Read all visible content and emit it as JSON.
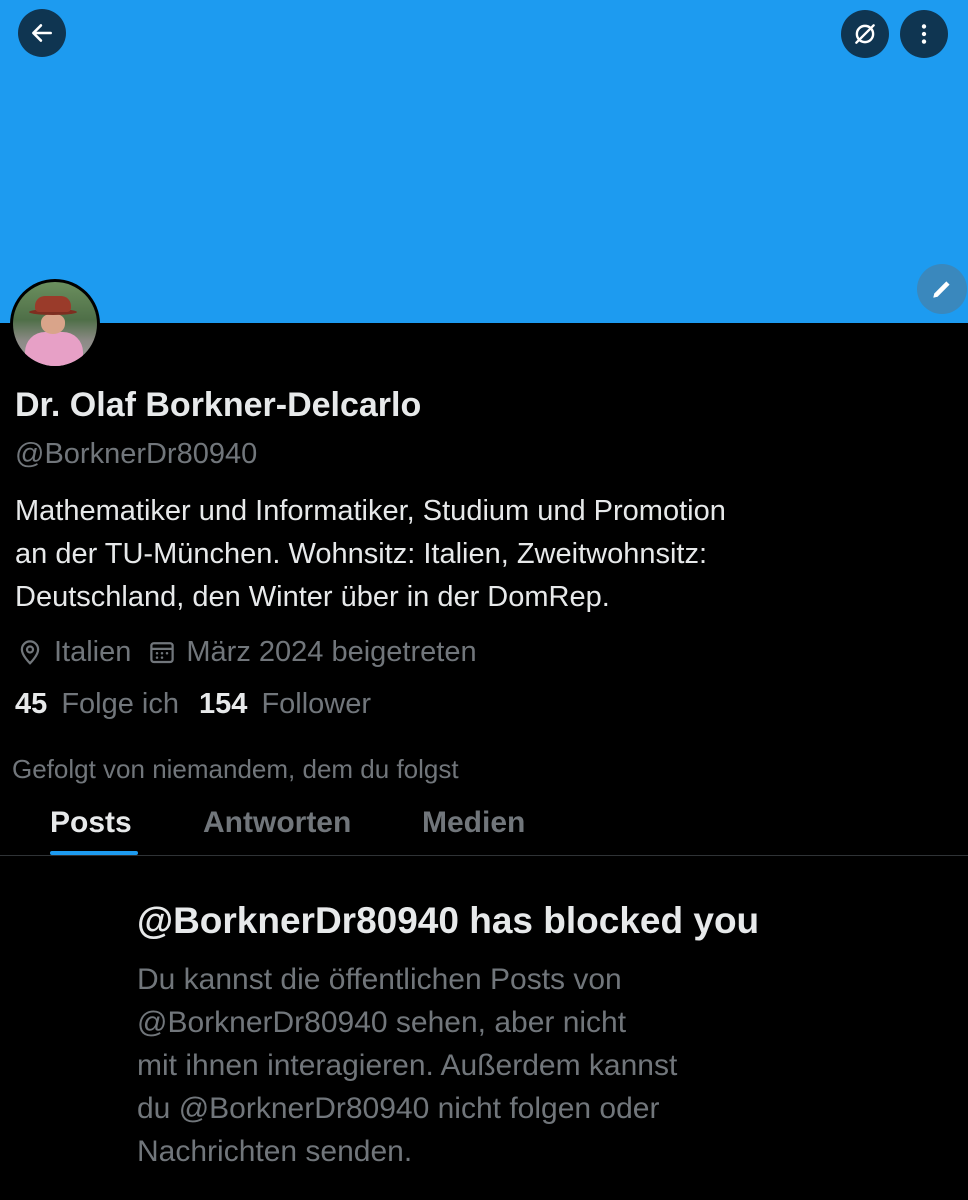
{
  "profile": {
    "name": "Dr. Olaf Borkner-Delcarlo",
    "handle": "@BorknerDr80940",
    "bio_lines": [
      "Mathematiker und Informatiker, Studium und Promotion",
      "an der TU-München. Wohnsitz: Italien, Zweitwohnsitz:",
      "Deutschland, den Winter über in der DomRep."
    ],
    "location": "Italien",
    "joined": "März 2024 beigetreten",
    "following_count": "45",
    "following_label": "Folge ich",
    "followers_count": "154",
    "followers_label": "Follower",
    "followed_by": "Gefolgt von niemandem, dem du folgst"
  },
  "tabs": [
    {
      "label": "Posts",
      "active": true
    },
    {
      "label": "Antworten",
      "active": false
    },
    {
      "label": "Medien",
      "active": false
    }
  ],
  "blocked": {
    "title": "@BorknerDr80940 has blocked you",
    "lines": [
      "Du kannst die öffentlichen Posts von",
      "@BorknerDr80940 sehen, aber nicht",
      "mit ihnen interagieren. Außerdem kannst",
      "du @BorknerDr80940 nicht folgen oder",
      "Nachrichten senden."
    ]
  },
  "icons": {
    "back": "arrow-left-icon",
    "notify": "bell-off-icon",
    "more": "more-vertical-icon",
    "edit": "pencil-icon",
    "location": "map-pin-icon",
    "joined": "calendar-icon"
  },
  "colors": {
    "banner": "#1d9bf0",
    "accent": "#1d9bf0",
    "background": "#000000",
    "text_primary": "#e7e9ea",
    "text_secondary": "#71767b"
  }
}
